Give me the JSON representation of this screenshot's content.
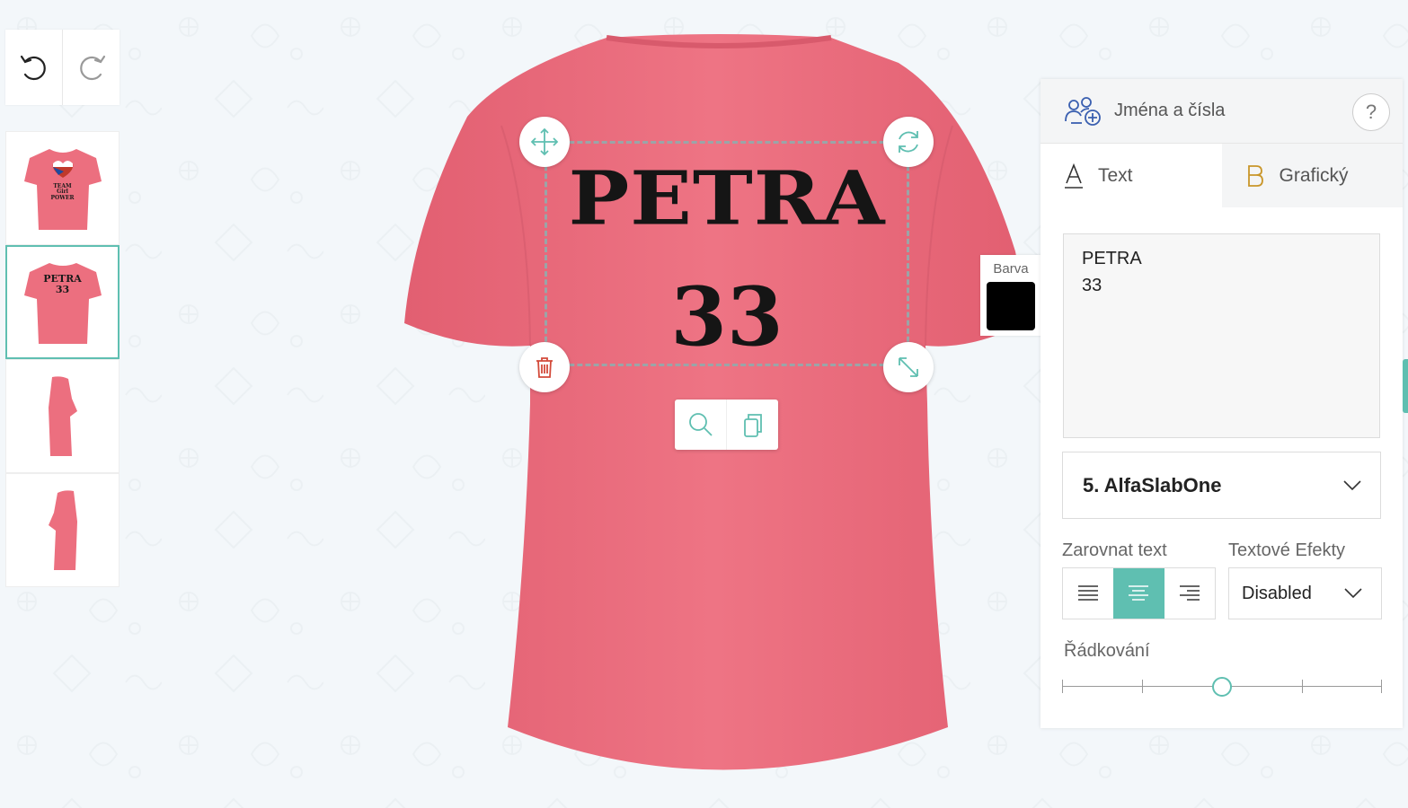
{
  "colors": {
    "accent": "#5fbfb1",
    "shirt": "#ec6f7f",
    "swatch": "#000000",
    "icon_blue": "#3a5fb0",
    "icon_gold": "#c9962a",
    "trash_red": "#d34a3a"
  },
  "history": {
    "undo_icon": "undo-icon",
    "redo_icon": "redo-icon"
  },
  "thumbs": {
    "front": [
      "TEAM",
      "Girl",
      "POWER"
    ],
    "back": [
      "PETRA",
      "33"
    ]
  },
  "design": {
    "line1": "PETRA",
    "line2": "33"
  },
  "barva": {
    "label": "Barva",
    "color": "#000000"
  },
  "panel": {
    "title": "Jména a čísla",
    "help": "?",
    "tabs": [
      {
        "label": "Text"
      },
      {
        "label": "Grafický"
      }
    ],
    "text_value": "PETRA\n33",
    "font": "5. AlfaSlabOne",
    "align_label": "Zarovnat text",
    "align_active": "center",
    "effects_label": "Textové Efekty",
    "effects_value": "Disabled",
    "spacing_label": "Řádkování",
    "spacing_value": 0.5
  }
}
